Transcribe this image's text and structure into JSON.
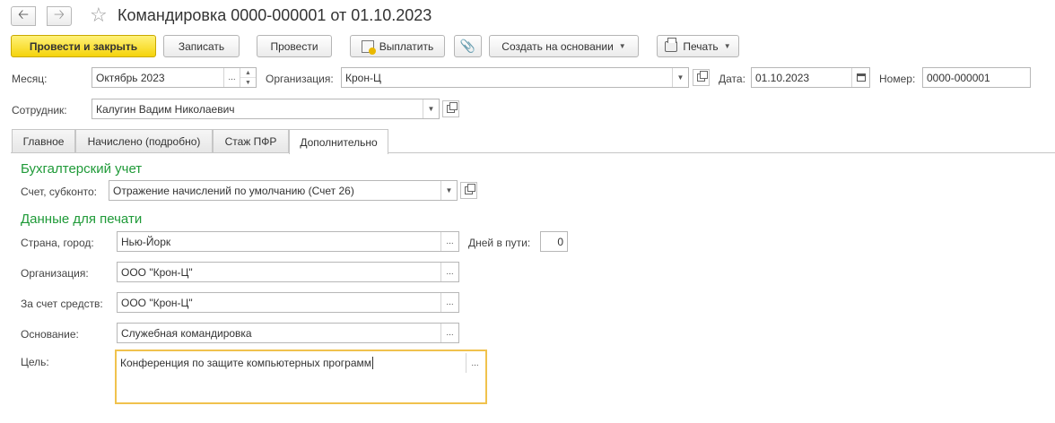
{
  "header": {
    "title": "Командировка 0000-000001 от 01.10.2023"
  },
  "toolbar": {
    "post_close": "Провести и закрыть",
    "save": "Записать",
    "post": "Провести",
    "pay": "Выплатить",
    "create_based_on": "Создать на основании",
    "print": "Печать"
  },
  "form": {
    "month_label": "Месяц:",
    "month_value": "Октябрь 2023",
    "org_label": "Организация:",
    "org_value": "Крон-Ц",
    "date_label": "Дата:",
    "date_value": "01.10.2023",
    "number_label": "Номер:",
    "number_value": "0000-000001",
    "employee_label": "Сотрудник:",
    "employee_value": "Калугин Вадим Николаевич"
  },
  "tabs": [
    {
      "label": "Главное"
    },
    {
      "label": "Начислено (подробно)"
    },
    {
      "label": "Стаж ПФР"
    },
    {
      "label": "Дополнительно"
    }
  ],
  "accounting": {
    "heading": "Бухгалтерский учет",
    "account_label": "Счет, субконто:",
    "account_value": "Отражение начислений по умолчанию (Счет 26)"
  },
  "print_data": {
    "heading": "Данные для печати",
    "city_label": "Страна, город:",
    "city_value": "Нью-Йорк",
    "days_label": "Дней в пути:",
    "days_value": "0",
    "org_label": "Организация:",
    "org_value": "ООО \"Крон-Ц\"",
    "funds_label": "За счет средств:",
    "funds_value": "ООО \"Крон-Ц\"",
    "basis_label": "Основание:",
    "basis_value": "Служебная командировка",
    "goal_label": "Цель:",
    "goal_value": "Конференция по защите компьютерных программ"
  },
  "icons": {
    "back": "arrow-left-icon",
    "forward": "arrow-right-icon",
    "favorite": "star-icon"
  },
  "colors": {
    "primary_button": "#f5d30b",
    "section_heading": "#1f9a38",
    "focus_border": "#f0c24d"
  }
}
